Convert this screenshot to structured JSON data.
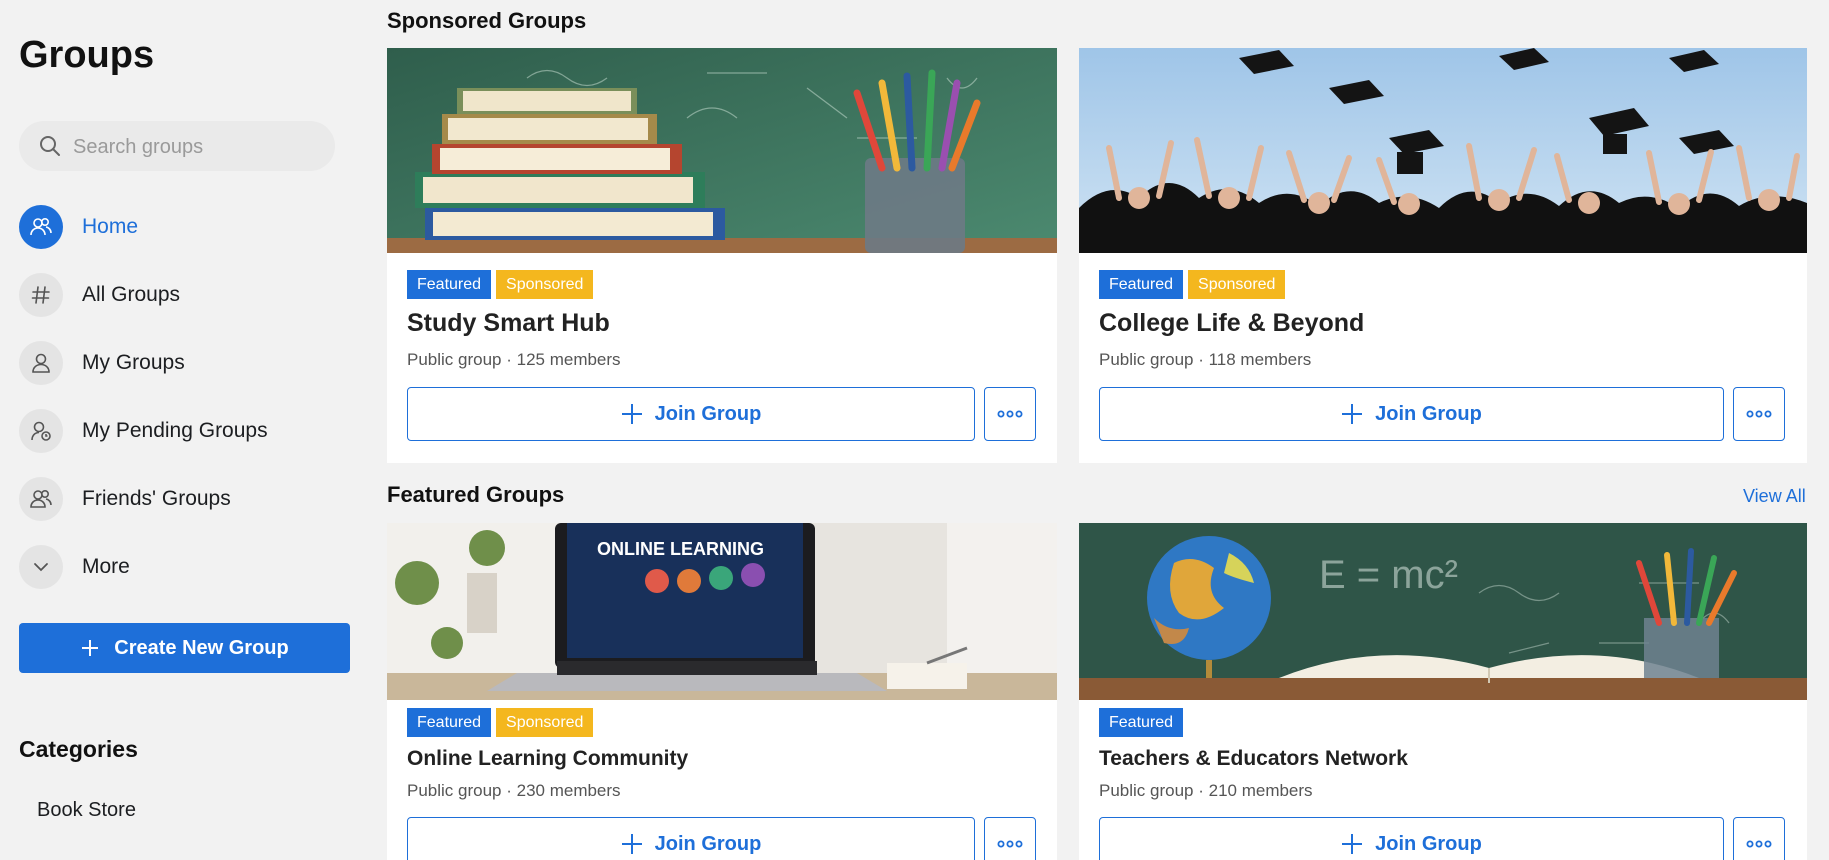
{
  "sidebar": {
    "title": "Groups",
    "search": {
      "placeholder": "Search groups",
      "value": ""
    },
    "nav": [
      {
        "label": "Home",
        "icon": "groups-icon",
        "active": true
      },
      {
        "label": "All Groups",
        "icon": "hash-icon"
      },
      {
        "label": "My Groups",
        "icon": "user-icon"
      },
      {
        "label": "My Pending Groups",
        "icon": "pending-user-icon"
      },
      {
        "label": "Friends' Groups",
        "icon": "friends-icon"
      },
      {
        "label": "More",
        "icon": "chevron-down-icon"
      }
    ],
    "create_button": "Create New Group",
    "categories_title": "Categories",
    "categories": [
      "Book Store"
    ]
  },
  "sponsored": {
    "title": "Sponsored Groups",
    "cards": [
      {
        "badges": [
          "Featured",
          "Sponsored"
        ],
        "name": "Study Smart Hub",
        "meta": "Public group · 125 members",
        "join": "Join Group",
        "image": "books-and-pencils-photo"
      },
      {
        "badges": [
          "Featured",
          "Sponsored"
        ],
        "name": "College Life & Beyond",
        "meta": "Public group · 118 members",
        "join": "Join Group",
        "image": "graduation-caps-photo"
      }
    ]
  },
  "featured": {
    "title": "Featured Groups",
    "view_all": "View All",
    "cards": [
      {
        "badges": [
          "Featured",
          "Sponsored"
        ],
        "name": "Online Learning Community",
        "meta": "Public group · 230 members",
        "join": "Join Group",
        "image": "laptop-online-learning-photo",
        "image_text": "ONLINE LEARNING"
      },
      {
        "badges": [
          "Featured"
        ],
        "name": "Teachers & Educators Network",
        "meta": "Public group · 210 members",
        "join": "Join Group",
        "image": "globe-and-book-photo",
        "image_text": "E = mc²"
      }
    ]
  },
  "colors": {
    "accent": "#1e6fd9",
    "sponsored": "#f4b71e",
    "background": "#f2f2f2"
  }
}
